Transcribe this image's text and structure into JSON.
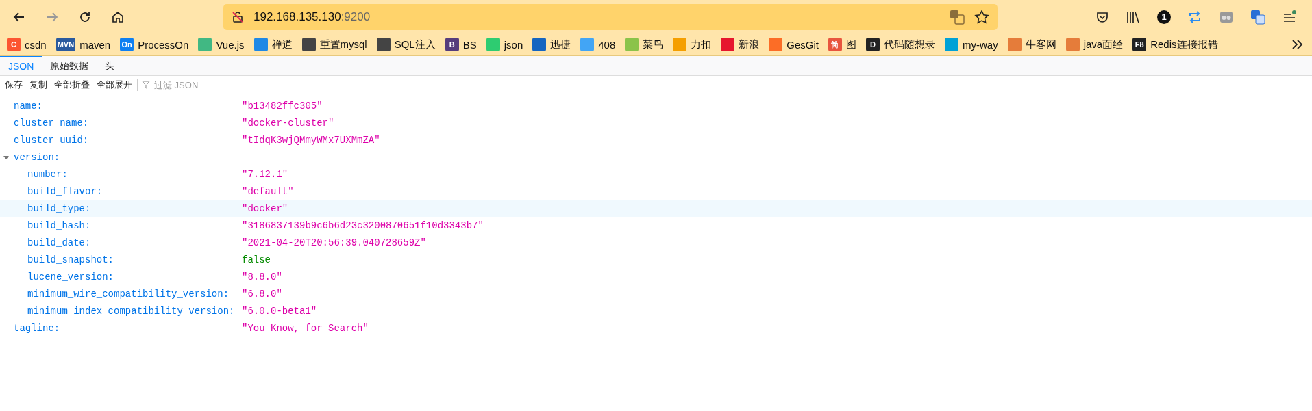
{
  "navigation": {
    "back_disabled": false,
    "forward_disabled": true
  },
  "address_bar": {
    "host": "192.168.135.130",
    "port": ":9200"
  },
  "toolbar_badge": "1",
  "bookmarks": [
    {
      "label": "csdn",
      "color": "#fc5531",
      "badge": "C"
    },
    {
      "label": "maven",
      "color": "#2a5a9e",
      "badge": "MVN"
    },
    {
      "label": "ProcessOn",
      "color": "#0f7ff1",
      "badge": "On"
    },
    {
      "label": "Vue.js",
      "color": "#41b883"
    },
    {
      "label": "禅道",
      "color": "#1e88e5"
    },
    {
      "label": "重置mysql",
      "color": "#444444"
    },
    {
      "label": "SQL注入",
      "color": "#444444"
    },
    {
      "label": "BS",
      "color": "#563d7c",
      "badge": "B"
    },
    {
      "label": "json",
      "color": "#2ecc71"
    },
    {
      "label": "迅捷",
      "color": "#1565c0"
    },
    {
      "label": "408",
      "color": "#42a5f5"
    },
    {
      "label": "菜鸟",
      "color": "#8bc34a"
    },
    {
      "label": "力扣",
      "color": "#f59f00"
    },
    {
      "label": "新浪",
      "color": "#e6162d"
    },
    {
      "label": "GesGit",
      "color": "#fc6d26"
    },
    {
      "label": "图",
      "color": "#e8553e",
      "badge": "简"
    },
    {
      "label": "代码随想录",
      "color": "#222222",
      "badge": "D"
    },
    {
      "label": "my-way",
      "color": "#00a1d6"
    },
    {
      "label": "牛客网",
      "color": "#e57c3a"
    },
    {
      "label": "java面经",
      "color": "#e57c3a"
    },
    {
      "label": "Redis连接报错",
      "color": "#222222",
      "badge": "F8"
    }
  ],
  "tabs": [
    {
      "label": "JSON",
      "selected": true
    },
    {
      "label": "原始数据",
      "selected": false
    },
    {
      "label": "头",
      "selected": false
    }
  ],
  "actions": [
    "保存",
    "复制",
    "全部折叠",
    "全部展开"
  ],
  "filter": {
    "placeholder": "过滤 JSON"
  },
  "rows": [
    {
      "key": "name:",
      "kind": "string",
      "value": "\"b13482ffc305\"",
      "highlighted": false
    },
    {
      "key": "cluster_name:",
      "kind": "string",
      "value": "\"docker-cluster\"",
      "highlighted": false
    },
    {
      "key": "cluster_uuid:",
      "kind": "string",
      "value": "\"tIdqK3wjQMmyWMx7UXMmZA\"",
      "highlighted": false
    },
    {
      "key": "version:",
      "kind": "object",
      "expanded": true,
      "highlighted": false,
      "children": [
        {
          "key": "number:",
          "kind": "string",
          "value": "\"7.12.1\"",
          "highlighted": false
        },
        {
          "key": "build_flavor:",
          "kind": "string",
          "value": "\"default\"",
          "highlighted": false
        },
        {
          "key": "build_type:",
          "kind": "string",
          "value": "\"docker\"",
          "highlighted": true
        },
        {
          "key": "build_hash:",
          "kind": "string",
          "value": "\"3186837139b9c6b6d23c3200870651f10d3343b7\"",
          "highlighted": false
        },
        {
          "key": "build_date:",
          "kind": "string",
          "value": "\"2021-04-20T20:56:39.040728659Z\"",
          "highlighted": false
        },
        {
          "key": "build_snapshot:",
          "kind": "boolean",
          "value": "false",
          "highlighted": false
        },
        {
          "key": "lucene_version:",
          "kind": "string",
          "value": "\"8.8.0\"",
          "highlighted": false
        },
        {
          "key": "minimum_wire_compatibility_version:",
          "kind": "string",
          "value": "\"6.8.0\"",
          "highlighted": false
        },
        {
          "key": "minimum_index_compatibility_version:",
          "kind": "string",
          "value": "\"6.0.0-beta1\"",
          "highlighted": false
        }
      ]
    },
    {
      "key": "tagline:",
      "kind": "string",
      "value": "\"You Know, for Search\"",
      "highlighted": false
    }
  ]
}
